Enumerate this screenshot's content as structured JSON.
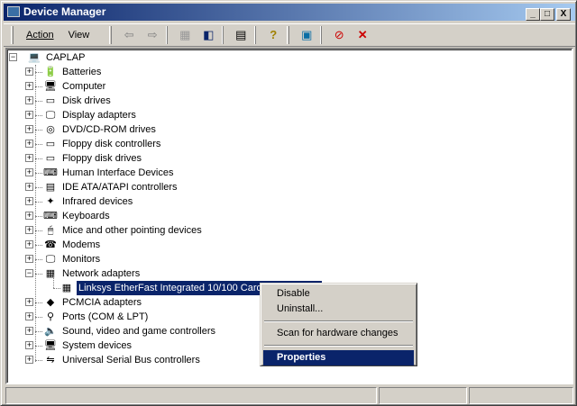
{
  "window": {
    "title": "Device Manager",
    "min": "_",
    "max": "□",
    "close": "X"
  },
  "menu": {
    "action": "Action",
    "view": "View"
  },
  "toolbar": {
    "icons": [
      "back-icon",
      "forward-icon",
      "up-icon",
      "show-hide-icon",
      "properties-icon",
      "help-icon",
      "scan-icon",
      "disable-icon",
      "uninstall-icon"
    ]
  },
  "tree": {
    "root": "CAPLAP",
    "categories": [
      {
        "label": "Batteries",
        "icon": "🔋"
      },
      {
        "label": "Computer",
        "icon": "🖥"
      },
      {
        "label": "Disk drives",
        "icon": "▭"
      },
      {
        "label": "Display adapters",
        "icon": "🖵"
      },
      {
        "label": "DVD/CD-ROM drives",
        "icon": "◎"
      },
      {
        "label": "Floppy disk controllers",
        "icon": "▭"
      },
      {
        "label": "Floppy disk drives",
        "icon": "▭"
      },
      {
        "label": "Human Interface Devices",
        "icon": "⌨"
      },
      {
        "label": "IDE ATA/ATAPI controllers",
        "icon": "▤"
      },
      {
        "label": "Infrared devices",
        "icon": "✦"
      },
      {
        "label": "Keyboards",
        "icon": "⌨"
      },
      {
        "label": "Mice and other pointing devices",
        "icon": "🖱"
      },
      {
        "label": "Modems",
        "icon": "☎"
      },
      {
        "label": "Monitors",
        "icon": "🖵"
      },
      {
        "label": "Network adapters",
        "icon": "▦",
        "expanded": true,
        "children": [
          "Linksys EtherFast Integrated 10/100 CardBus PC Card"
        ]
      },
      {
        "label": "PCMCIA adapters",
        "icon": "◆"
      },
      {
        "label": "Ports (COM & LPT)",
        "icon": "⚲"
      },
      {
        "label": "Sound, video and game controllers",
        "icon": "🔈"
      },
      {
        "label": "System devices",
        "icon": "🖥"
      },
      {
        "label": "Universal Serial Bus controllers",
        "icon": "⇋"
      }
    ]
  },
  "context_menu": {
    "items": [
      "Disable",
      "Uninstall...",
      "Scan for hardware changes",
      "Properties"
    ]
  }
}
